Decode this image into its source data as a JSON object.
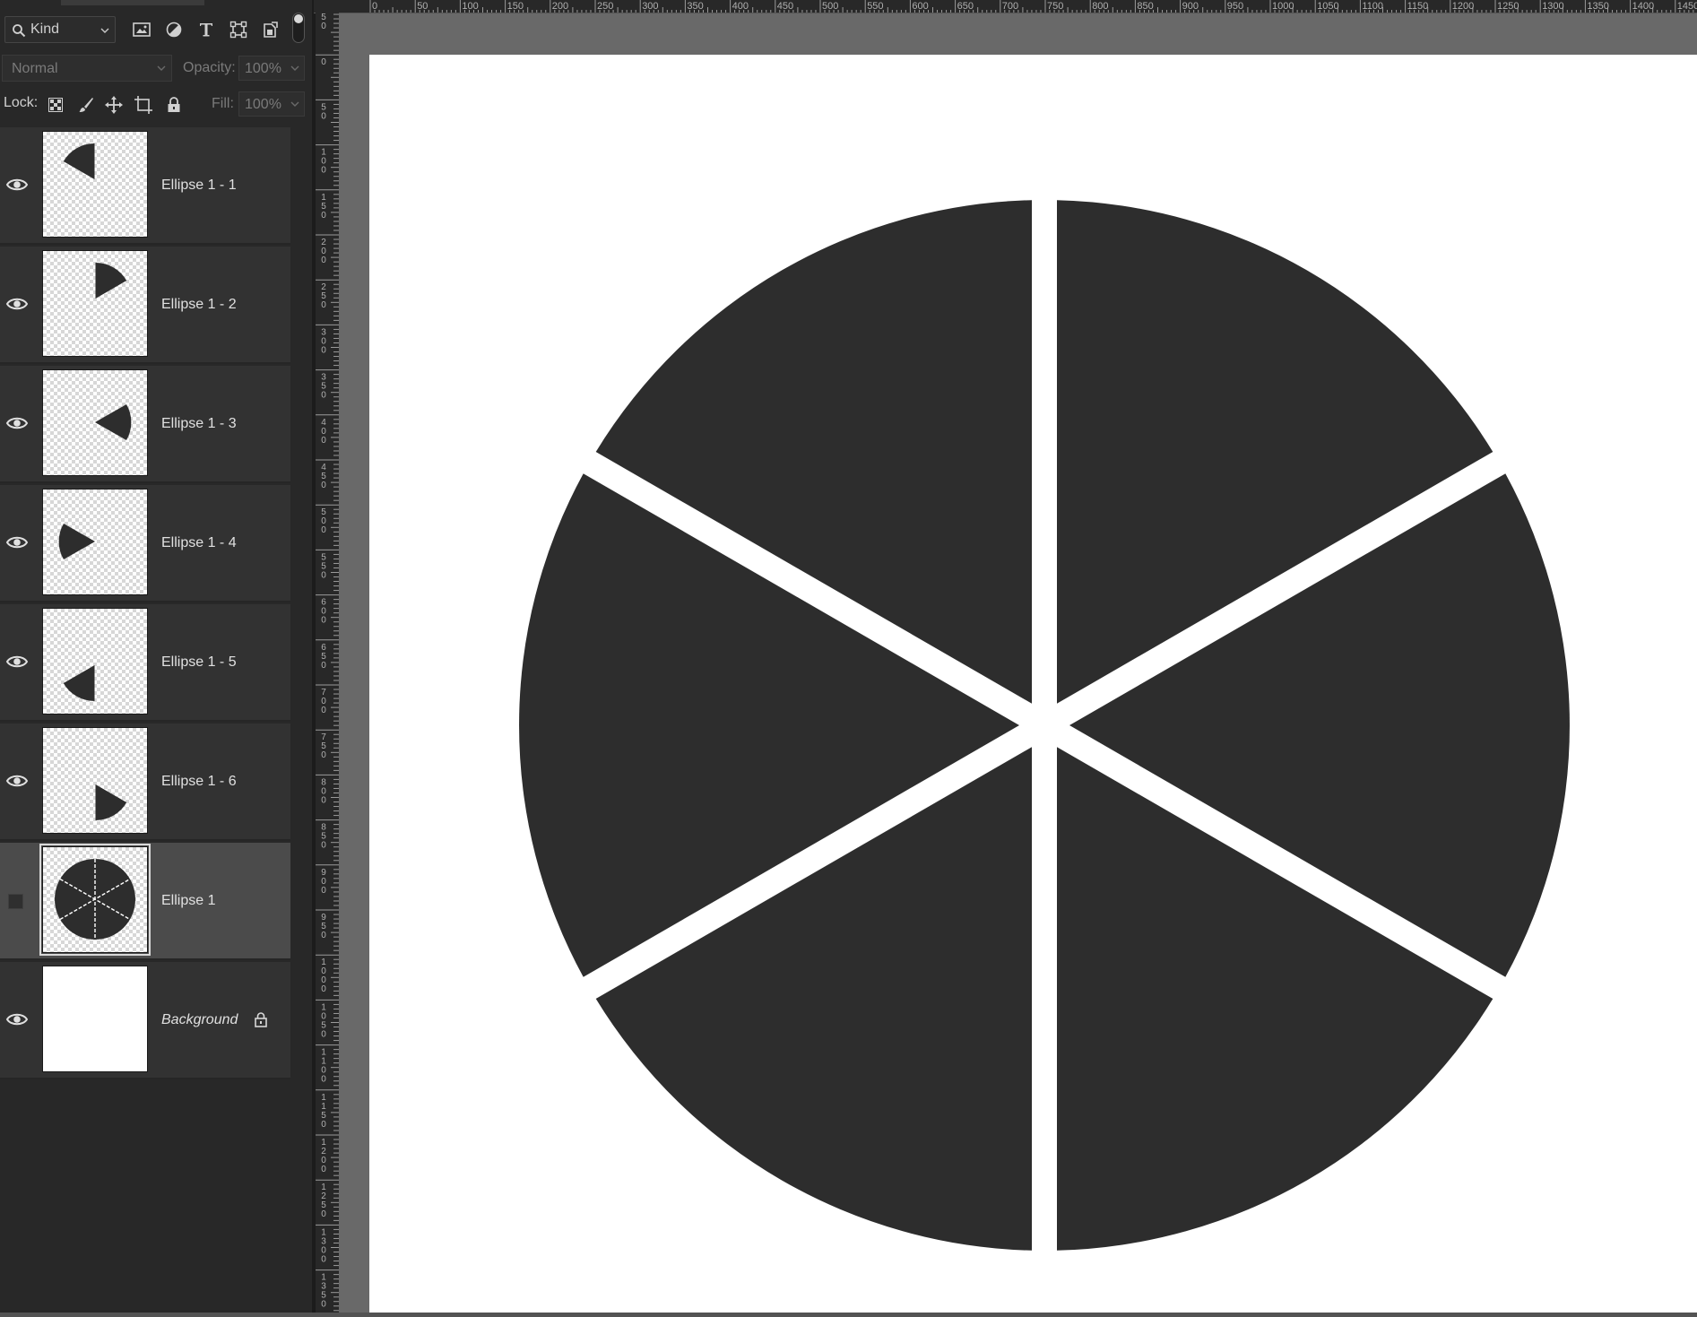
{
  "layers_panel": {
    "filter": {
      "kind_label": "Kind",
      "icons": [
        "image-filter-icon",
        "adjustment-filter-icon",
        "type-filter-icon",
        "shape-filter-icon",
        "smart-object-filter-icon"
      ]
    },
    "blend_mode": "Normal",
    "opacity": {
      "label": "Opacity:",
      "value": "100%"
    },
    "lock": {
      "label": "Lock:",
      "icons": [
        "lock-transparent-pixels-icon",
        "lock-image-pixels-icon",
        "lock-position-icon",
        "lock-artboard-icon",
        "lock-all-icon"
      ]
    },
    "fill": {
      "label": "Fill:",
      "value": "100%"
    },
    "layers": [
      {
        "name": "Ellipse 1 - 1",
        "visible": true,
        "selected": false
      },
      {
        "name": "Ellipse 1 - 2",
        "visible": true,
        "selected": false
      },
      {
        "name": "Ellipse 1 - 3",
        "visible": true,
        "selected": false
      },
      {
        "name": "Ellipse 1 - 4",
        "visible": true,
        "selected": false
      },
      {
        "name": "Ellipse 1 - 5",
        "visible": true,
        "selected": false
      },
      {
        "name": "Ellipse 1 - 6",
        "visible": true,
        "selected": false
      },
      {
        "name": "Ellipse 1",
        "visible": false,
        "selected": true
      },
      {
        "name": "Background",
        "visible": true,
        "selected": false,
        "locked": true
      }
    ]
  },
  "rulers": {
    "top_labels": [
      "0",
      "50",
      "100",
      "150",
      "200",
      "250",
      "300",
      "350",
      "400",
      "450",
      "500",
      "550",
      "600",
      "650",
      "700",
      "750",
      "800",
      "850",
      "900",
      "950",
      "1000",
      "1050",
      "1100",
      "1150",
      "1200",
      "1250",
      "1300",
      "1350",
      "1400",
      "1450"
    ],
    "left_labels": [
      "50",
      "0",
      "50",
      "100",
      "150",
      "200",
      "250",
      "300",
      "350",
      "400",
      "450",
      "500",
      "550",
      "600",
      "650",
      "700",
      "750",
      "800",
      "850",
      "900",
      "950",
      "1000",
      "1050",
      "1100",
      "1150",
      "1200",
      "1250",
      "1300",
      "1350"
    ]
  },
  "canvas": {
    "background": "#696969",
    "document_color": "#ffffff",
    "shape_color": "#2d2d2d",
    "slice_count": 6
  }
}
